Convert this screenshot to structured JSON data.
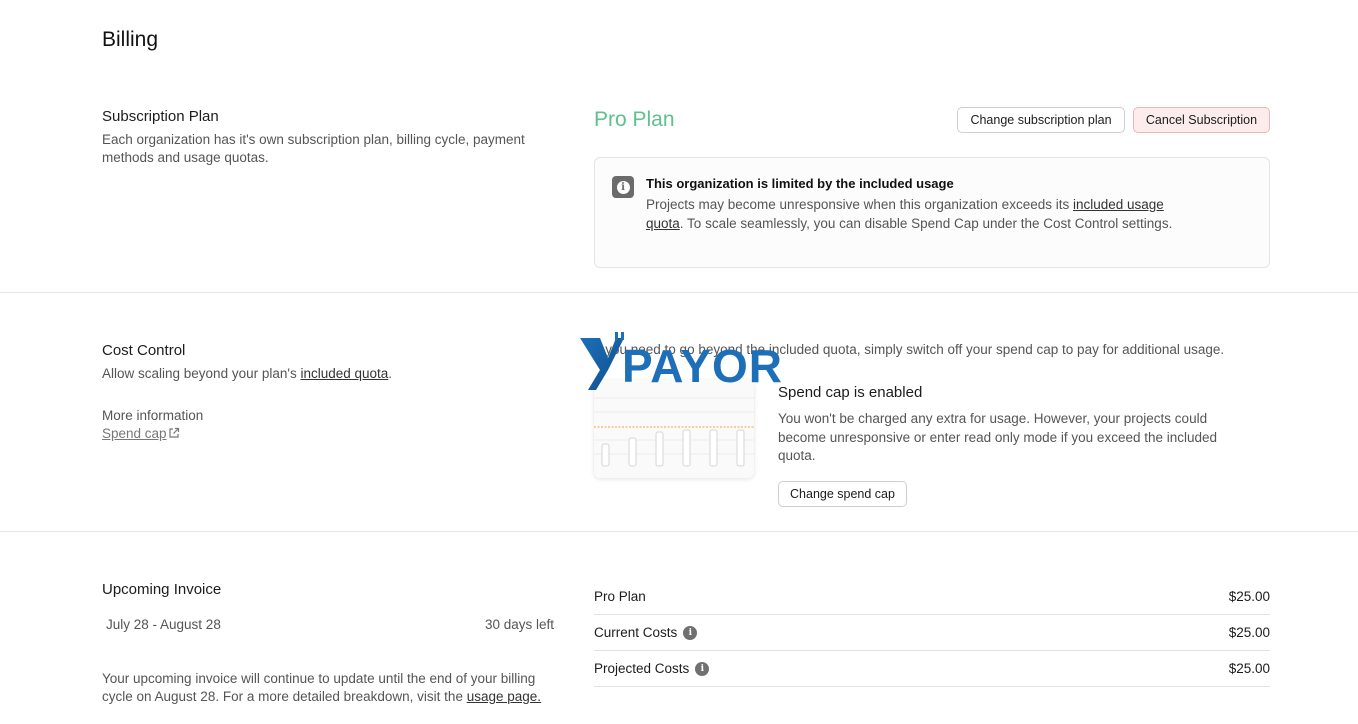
{
  "page": {
    "title": "Billing"
  },
  "subscription": {
    "title": "Subscription Plan",
    "description": "Each organization has it's own subscription plan, billing cycle, payment methods and usage quotas.",
    "plan_name": "Pro Plan",
    "plan_color": "#5fc08f",
    "change_button": "Change subscription plan",
    "cancel_button": "Cancel Subscription",
    "alert": {
      "icon": "info-icon",
      "title": "This organization is limited by the included usage",
      "body_prefix": "Projects may become unresponsive when this organization exceeds its ",
      "body_link": "included usage quota",
      "body_suffix": ". To scale seamlessly, you can disable Spend Cap under the Cost Control settings."
    }
  },
  "cost_control": {
    "title": "Cost Control",
    "description_prefix": "Allow scaling beyond your plan's ",
    "description_link": "included quota",
    "description_suffix": ".",
    "more_info_label": "More information",
    "spend_cap_link": "Spend cap",
    "intro_text": "If you need to go beyond the included quota, simply switch off your spend cap to pay for additional usage.",
    "logo_text": "PAYOR",
    "cap_title": "Spend cap is enabled",
    "cap_body": "You won't be charged any extra for usage. However, your projects could become unresponsive or enter read only mode if you exceed the included quota.",
    "change_cap_button": "Change spend cap"
  },
  "invoice": {
    "title": "Upcoming Invoice",
    "period": "July 28 - August 28",
    "days_left": "30 days left",
    "note_prefix": "Your upcoming invoice will continue to update until the end of your billing cycle on August 28. For a more detailed breakdown, visit the ",
    "note_link": "usage page.",
    "rows": [
      {
        "label": "Pro Plan",
        "value": "$25.00"
      },
      {
        "label": "Current Costs",
        "value": "$25.00"
      },
      {
        "label": "Projected Costs",
        "value": "$25.00"
      }
    ]
  }
}
